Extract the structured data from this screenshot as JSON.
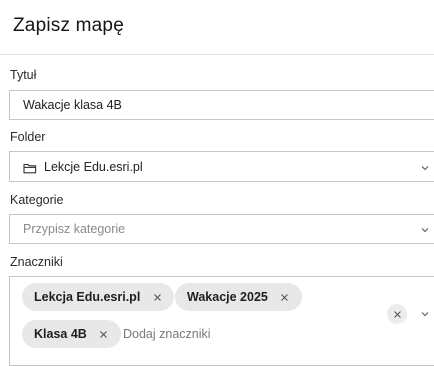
{
  "dialog": {
    "title": "Zapisz mapę"
  },
  "fields": {
    "title": {
      "label": "Tytuł",
      "value": "Wakacje klasa 4B"
    },
    "folder": {
      "label": "Folder",
      "value": "Lekcje Edu.esri.pl",
      "icon": "folder-icon"
    },
    "category": {
      "label": "Kategorie",
      "placeholder": "Przypisz kategorie"
    },
    "tags": {
      "label": "Znaczniki",
      "chips": [
        {
          "label": "Lekcja Edu.esri.pl"
        },
        {
          "label": "Wakacje 2025"
        },
        {
          "label": "Klasa 4B"
        }
      ],
      "input_placeholder": "Dodaj znaczniki"
    }
  },
  "colors": {
    "border": "#c6c6c6",
    "chip_background": "#e8e8e8",
    "placeholder_text": "#8a8a8a"
  }
}
